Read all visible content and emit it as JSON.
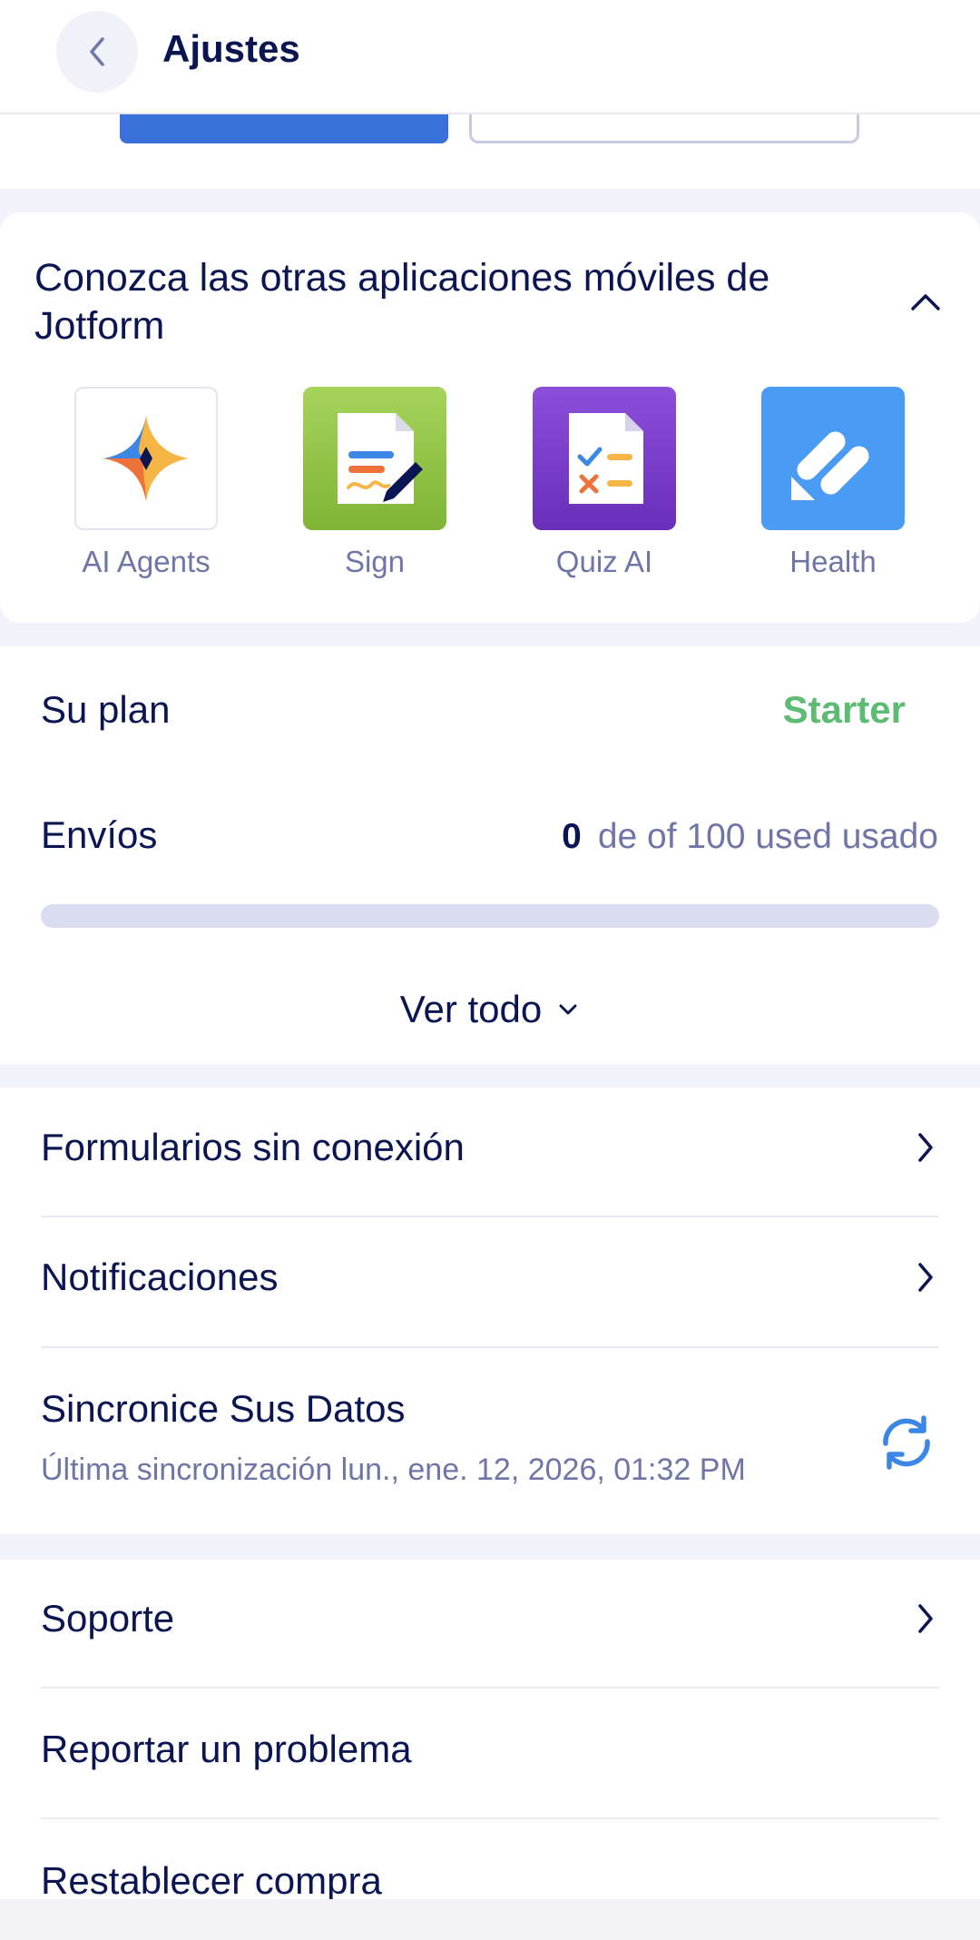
{
  "header": {
    "title": "Ajustes"
  },
  "apps": {
    "title": "Conozca las otras aplicaciones móviles de Jotform",
    "items": [
      {
        "label": "AI Agents",
        "icon": "ai-agents-app-icon"
      },
      {
        "label": "Sign",
        "icon": "sign-app-icon"
      },
      {
        "label": "Quiz AI",
        "icon": "quiz-ai-app-icon"
      },
      {
        "label": "Health",
        "icon": "health-app-icon"
      }
    ]
  },
  "plan": {
    "label": "Su plan",
    "value": "Starter",
    "submissions_label": "Envíos",
    "submissions_used": "0",
    "submissions_text": "de of 100 used usado",
    "progress_fraction": 0,
    "see_all": "Ver todo"
  },
  "settings": {
    "offline_forms": "Formularios sin conexión",
    "notifications": "Notificaciones",
    "sync_title": "Sincronice Sus Datos",
    "sync_subtitle": "Última sincronización lun., ene. 12, 2026, 01:32 PM",
    "support": "Soporte",
    "report_problem": "Reportar un problema",
    "restore_purchase": "Restablecer compra"
  },
  "colors": {
    "accent": "#3a70d9",
    "starter": "#5dbb73",
    "navy": "#0a1551",
    "muted": "#6f76a7"
  }
}
